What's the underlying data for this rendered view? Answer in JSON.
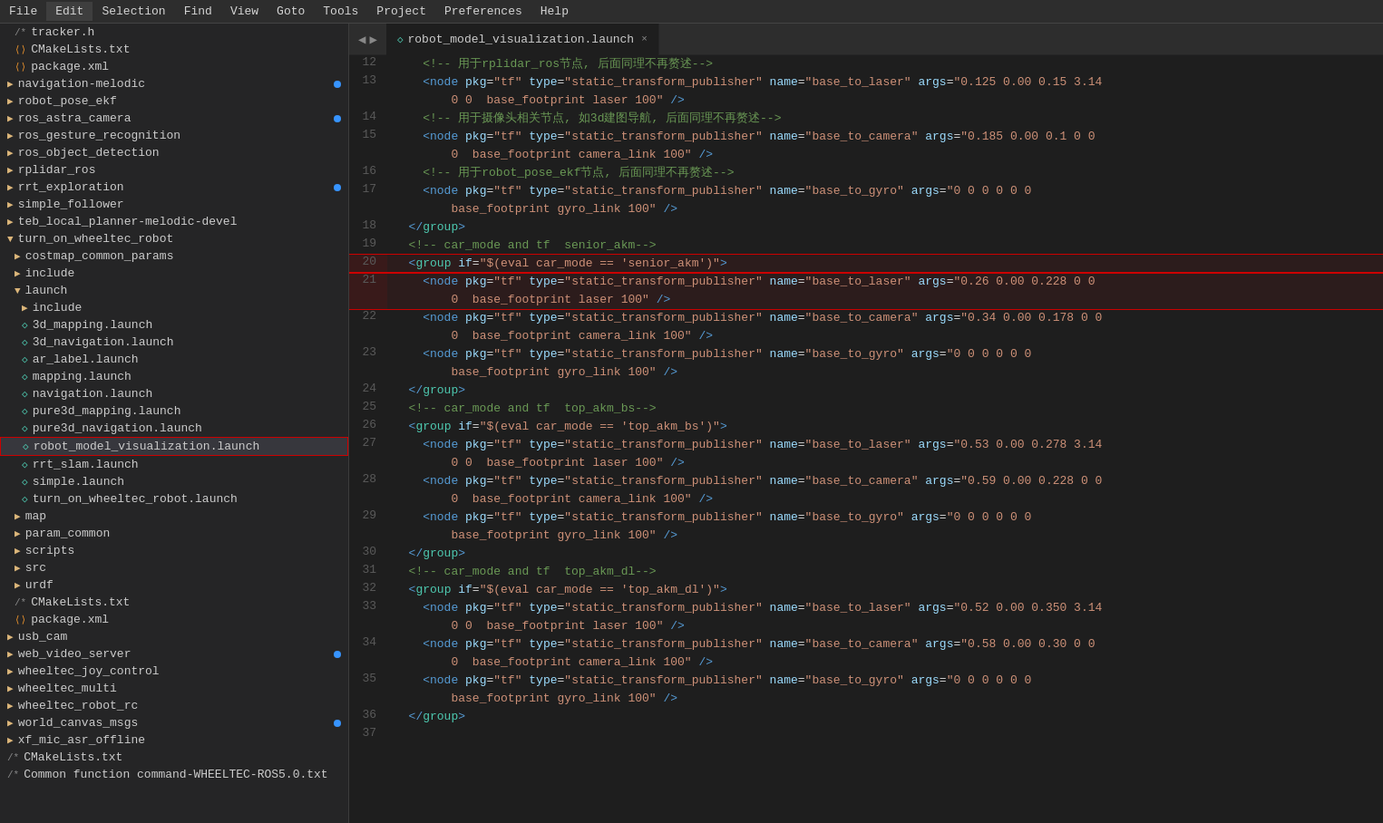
{
  "menu": {
    "items": [
      "File",
      "Edit",
      "Selection",
      "Find",
      "View",
      "Goto",
      "Tools",
      "Project",
      "Preferences",
      "Help"
    ]
  },
  "tabs": {
    "arrows": [
      "◀",
      "▶"
    ],
    "active_tab": {
      "icon": "◇",
      "label": "robot_model_visualization.launch",
      "close": "×"
    }
  },
  "sidebar": {
    "items": [
      {
        "indent": 16,
        "type": "file-txt",
        "icon": "/*",
        "label": "tracker.h"
      },
      {
        "indent": 16,
        "type": "file-xml",
        "icon": "⟨⟩",
        "label": "CMakeLists.txt"
      },
      {
        "indent": 16,
        "type": "file-xml",
        "icon": "⟨⟩",
        "label": "package.xml"
      },
      {
        "indent": 8,
        "type": "folder",
        "icon": "▶",
        "label": "navigation-melodic",
        "dot": true
      },
      {
        "indent": 8,
        "type": "folder",
        "icon": "▶",
        "label": "robot_pose_ekf"
      },
      {
        "indent": 8,
        "type": "folder",
        "icon": "▶",
        "label": "ros_astra_camera",
        "dot": true
      },
      {
        "indent": 8,
        "type": "folder",
        "icon": "▶",
        "label": "ros_gesture_recognition"
      },
      {
        "indent": 8,
        "type": "folder",
        "icon": "▶",
        "label": "ros_object_detection"
      },
      {
        "indent": 8,
        "type": "folder",
        "icon": "▶",
        "label": "rplidar_ros"
      },
      {
        "indent": 8,
        "type": "folder",
        "icon": "▶",
        "label": "rrt_exploration",
        "dot": true
      },
      {
        "indent": 8,
        "type": "folder",
        "icon": "▶",
        "label": "simple_follower"
      },
      {
        "indent": 8,
        "type": "folder",
        "icon": "▶",
        "label": "teb_local_planner-melodic-devel"
      },
      {
        "indent": 8,
        "type": "folder-open",
        "icon": "▼",
        "label": "turn_on_wheeltec_robot"
      },
      {
        "indent": 16,
        "type": "folder",
        "icon": "▶",
        "label": "costmap_common_params"
      },
      {
        "indent": 16,
        "type": "folder",
        "icon": "▶",
        "label": "include"
      },
      {
        "indent": 16,
        "type": "folder-open",
        "icon": "▼",
        "label": "launch"
      },
      {
        "indent": 24,
        "type": "folder",
        "icon": "▶",
        "label": "include"
      },
      {
        "indent": 24,
        "type": "file-launch",
        "icon": "⟨⟩",
        "label": "3d_mapping.launch"
      },
      {
        "indent": 24,
        "type": "file-launch",
        "icon": "⟨⟩",
        "label": "3d_navigation.launch"
      },
      {
        "indent": 24,
        "type": "file-launch",
        "icon": "⟨⟩",
        "label": "ar_label.launch"
      },
      {
        "indent": 24,
        "type": "file-launch",
        "icon": "⟨⟩",
        "label": "mapping.launch"
      },
      {
        "indent": 24,
        "type": "file-launch",
        "icon": "⟨⟩",
        "label": "navigation.launch"
      },
      {
        "indent": 24,
        "type": "file-launch",
        "icon": "⟨⟩",
        "label": "pure3d_mapping.launch"
      },
      {
        "indent": 24,
        "type": "file-launch",
        "icon": "⟨⟩",
        "label": "pure3d_navigation.launch"
      },
      {
        "indent": 24,
        "type": "file-launch",
        "icon": "⟨⟩",
        "label": "robot_model_visualization.launch",
        "selected": true
      },
      {
        "indent": 24,
        "type": "file-launch",
        "icon": "⟨⟩",
        "label": "rrt_slam.launch"
      },
      {
        "indent": 24,
        "type": "file-launch",
        "icon": "⟨⟩",
        "label": "simple.launch"
      },
      {
        "indent": 24,
        "type": "file-launch",
        "icon": "⟨⟩",
        "label": "turn_on_wheeltec_robot.launch"
      },
      {
        "indent": 16,
        "type": "folder",
        "icon": "▶",
        "label": "map"
      },
      {
        "indent": 16,
        "type": "folder",
        "icon": "▶",
        "label": "param_common"
      },
      {
        "indent": 16,
        "type": "folder",
        "icon": "▶",
        "label": "scripts"
      },
      {
        "indent": 16,
        "type": "folder",
        "icon": "▶",
        "label": "src"
      },
      {
        "indent": 16,
        "type": "folder",
        "icon": "▶",
        "label": "urdf"
      },
      {
        "indent": 16,
        "type": "file-txt",
        "icon": "/*",
        "label": "CMakeLists.txt"
      },
      {
        "indent": 16,
        "type": "file-xml",
        "icon": "⟨⟩",
        "label": "package.xml"
      },
      {
        "indent": 8,
        "type": "folder",
        "icon": "▶",
        "label": "usb_cam"
      },
      {
        "indent": 8,
        "type": "folder",
        "icon": "▶",
        "label": "web_video_server",
        "dot": true
      },
      {
        "indent": 8,
        "type": "folder",
        "icon": "▶",
        "label": "wheeltec_joy_control"
      },
      {
        "indent": 8,
        "type": "folder",
        "icon": "▶",
        "label": "wheeltec_multi"
      },
      {
        "indent": 8,
        "type": "folder",
        "icon": "▶",
        "label": "wheeltec_robot_rc"
      },
      {
        "indent": 8,
        "type": "folder",
        "icon": "▶",
        "label": "world_canvas_msgs",
        "dot": true
      },
      {
        "indent": 8,
        "type": "folder",
        "icon": "▶",
        "label": "xf_mic_asr_offline"
      },
      {
        "indent": 8,
        "type": "file-txt",
        "icon": "/*",
        "label": "CMakeLists.txt"
      },
      {
        "indent": 8,
        "type": "file-txt",
        "icon": "/*",
        "label": "Common function command-WHEELTEC-ROS5.0.txt"
      }
    ]
  },
  "code": {
    "lines": [
      {
        "num": 12,
        "content": "    <!-- 用于rplidar_ros节点, 后面同理不再赘述-->",
        "type": "comment"
      },
      {
        "num": 13,
        "content": "    <node pkg=\"tf\" type=\"static_transform_publisher\" name=\"base_to_laser\" args=\"0.125 0.00 0.15 3.14\n        0 0  base_footprint laser 100\" />",
        "type": "node"
      },
      {
        "num": 14,
        "content": "    <!-- 用于摄像头相关节点, 如3d建图导航, 后面同理不再赘述-->",
        "type": "comment"
      },
      {
        "num": 15,
        "content": "    <node pkg=\"tf\" type=\"static_transform_publisher\" name=\"base_to_camera\" args=\"0.185 0.00 0.1 0 0\n        0  base_footprint camera_link 100\" />",
        "type": "node"
      },
      {
        "num": 16,
        "content": "    <!-- 用于robot_pose_ekf节点, 后面同理不再赘述-->",
        "type": "comment"
      },
      {
        "num": 17,
        "content": "    <node pkg=\"tf\" type=\"static_transform_publisher\" name=\"base_to_gyro\" args=\"0 0 0 0 0 0\n        base_footprint gyro_link 100\" />",
        "type": "node"
      },
      {
        "num": 18,
        "content": "  </group>",
        "type": "group-close"
      },
      {
        "num": 19,
        "content": "  <!-- car_mode and tf  senior_akm-->",
        "type": "comment"
      },
      {
        "num": 20,
        "content": "  <group if=\"$(eval car_mode == 'senior_akm')\">",
        "type": "group-open",
        "highlight": true
      },
      {
        "num": 21,
        "content": "    <node pkg=\"tf\" type=\"static_transform_publisher\" name=\"base_to_laser\" args=\"0.26 0.00 0.228 0 0\n        0  base_footprint laser 100\" />",
        "type": "node",
        "highlight": true
      },
      {
        "num": 22,
        "content": "    <node pkg=\"tf\" type=\"static_transform_publisher\" name=\"base_to_camera\" args=\"0.34 0.00 0.178 0 0\n        0  base_footprint camera_link 100\" />",
        "type": "node"
      },
      {
        "num": 23,
        "content": "    <node pkg=\"tf\" type=\"static_transform_publisher\" name=\"base_to_gyro\" args=\"0 0 0 0 0 0\n        base_footprint gyro_link 100\" />",
        "type": "node"
      },
      {
        "num": 24,
        "content": "  </group>",
        "type": "group-close"
      },
      {
        "num": 25,
        "content": "  <!-- car_mode and tf  top_akm_bs-->",
        "type": "comment"
      },
      {
        "num": 26,
        "content": "  <group if=\"$(eval car_mode == 'top_akm_bs')\">",
        "type": "group-open"
      },
      {
        "num": 27,
        "content": "    <node pkg=\"tf\" type=\"static_transform_publisher\" name=\"base_to_laser\" args=\"0.53 0.00 0.278 3.14\n        0 0  base_footprint laser 100\" />",
        "type": "node"
      },
      {
        "num": 28,
        "content": "    <node pkg=\"tf\" type=\"static_transform_publisher\" name=\"base_to_camera\" args=\"0.59 0.00 0.228 0 0\n        0  base_footprint camera_link 100\" />",
        "type": "node"
      },
      {
        "num": 29,
        "content": "    <node pkg=\"tf\" type=\"static_transform_publisher\" name=\"base_to_gyro\" args=\"0 0 0 0 0 0\n        base_footprint gyro_link 100\" />",
        "type": "node"
      },
      {
        "num": 30,
        "content": "  </group>",
        "type": "group-close"
      },
      {
        "num": 31,
        "content": "  <!-- car_mode and tf  top_akm_dl-->",
        "type": "comment"
      },
      {
        "num": 32,
        "content": "  <group if=\"$(eval car_mode == 'top_akm_dl')\">",
        "type": "group-open"
      },
      {
        "num": 33,
        "content": "    <node pkg=\"tf\" type=\"static_transform_publisher\" name=\"base_to_laser\" args=\"0.52 0.00 0.350 3.14\n        0 0  base_footprint laser 100\" />",
        "type": "node"
      },
      {
        "num": 34,
        "content": "    <node pkg=\"tf\" type=\"static_transform_publisher\" name=\"base_to_camera\" args=\"0.58 0.00 0.30 0 0\n        0  base_footprint camera_link 100\" />",
        "type": "node"
      },
      {
        "num": 35,
        "content": "    <node pkg=\"tf\" type=\"static_transform_publisher\" name=\"base_to_gyro\" args=\"0 0 0 0 0 0\n        base_footprint gyro_link 100\" />",
        "type": "node"
      },
      {
        "num": 36,
        "content": "  </group>",
        "type": "group-close"
      },
      {
        "num": 37,
        "content": "",
        "type": "empty"
      }
    ]
  }
}
